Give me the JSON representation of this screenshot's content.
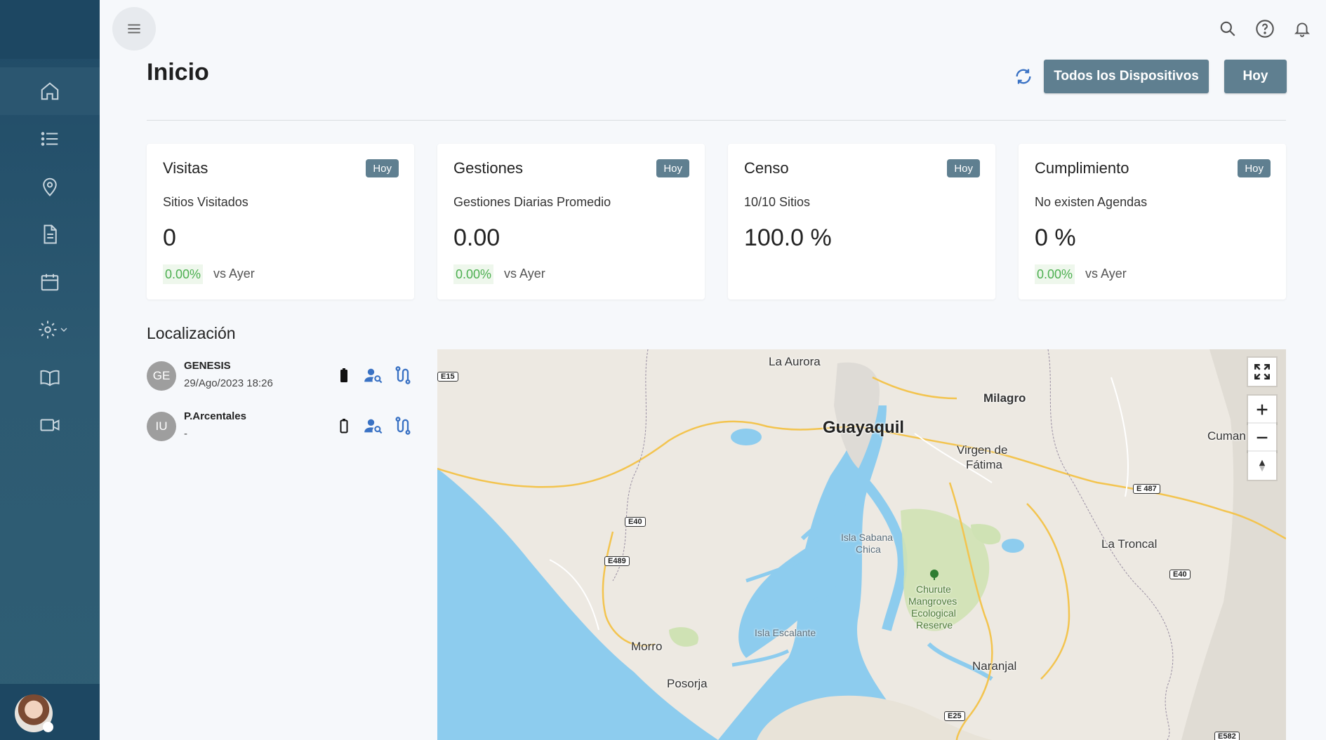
{
  "header": {
    "title": "Inicio",
    "devices_button": "Todos los Dispositivos",
    "date_button": "Hoy"
  },
  "cards": [
    {
      "title": "Visitas",
      "badge": "Hoy",
      "subtitle": "Sitios Visitados",
      "value": "0",
      "change": "0.00%",
      "compare": "vs Ayer"
    },
    {
      "title": "Gestiones",
      "badge": "Hoy",
      "subtitle": "Gestiones Diarias Promedio",
      "value": "0.00",
      "change": "0.00%",
      "compare": "vs Ayer"
    },
    {
      "title": "Censo",
      "badge": "Hoy",
      "subtitle": "10/10 Sitios",
      "value": "100.0 %"
    },
    {
      "title": "Cumplimiento",
      "badge": "Hoy",
      "subtitle": "No existen Agendas",
      "value": "0 %",
      "change": "0.00%",
      "compare": "vs Ayer"
    }
  ],
  "location": {
    "title": "Localización",
    "devices": [
      {
        "initials": "GE",
        "name": "GENESIS",
        "last_seen": "29/Ago/2023 18:26",
        "battery": "full"
      },
      {
        "initials": "IU",
        "name": "P.Arcentales",
        "last_seen": "-",
        "battery": "empty"
      }
    ]
  },
  "map": {
    "labels": {
      "la_aurora": "La Aurora",
      "milagro": "Milagro",
      "guayaquil": "Guayaquil",
      "virgen": "Virgen de",
      "fatima": "Fátima",
      "cuman": "Cuman",
      "la_troncal": "La Troncal",
      "isla_sabana": "Isla Sabana",
      "chica": "Chica",
      "churute1": "Churute",
      "churute2": "Mangroves",
      "churute3": "Ecological",
      "churute4": "Reserve",
      "isla_escalante": "Isla Escalante",
      "morro": "Morro",
      "posorja": "Posorja",
      "naranjal": "Naranjal"
    },
    "roads": {
      "e15": "E15",
      "e40a": "E40",
      "e489": "E489",
      "e487": "E 487",
      "e40b": "E40",
      "e25": "E25",
      "e582": "E582"
    }
  },
  "colors": {
    "sidebar": "#1f4a66",
    "button": "#5f7f90",
    "accent_blue": "#3a72c4",
    "positive": "#4caf50",
    "water": "#8dccee"
  },
  "icons": {
    "nav": [
      "home-icon",
      "list-icon",
      "location-pin-icon",
      "document-icon",
      "calendar-icon",
      "gear-icon",
      "book-icon",
      "video-icon"
    ],
    "top": [
      "menu-icon",
      "search-icon",
      "help-icon",
      "bell-icon",
      "refresh-icon"
    ]
  }
}
